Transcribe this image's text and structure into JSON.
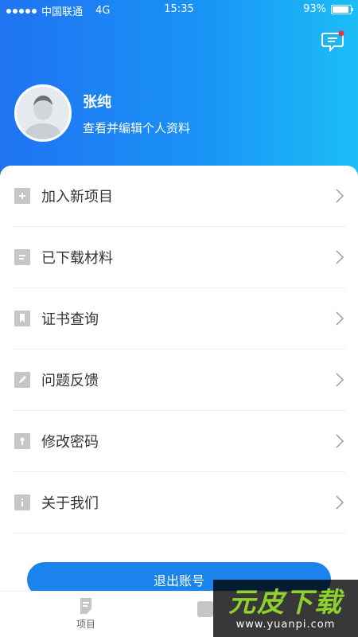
{
  "status_bar": {
    "carrier": "中国联通",
    "network": "4G",
    "time": "15:35",
    "battery": "93%",
    "battery_level": 0.93
  },
  "header": {
    "message_icon": "message-icon",
    "message_badge_color": "#e8343b"
  },
  "profile": {
    "name": "张纯",
    "edit_link": "查看并编辑个人资料"
  },
  "menu": {
    "items": [
      {
        "label": "加入新项目",
        "icon": "add-document-icon"
      },
      {
        "label": "已下载材料",
        "icon": "document-icon"
      },
      {
        "label": "证书查询",
        "icon": "bookmark-icon"
      },
      {
        "label": "问题反馈",
        "icon": "pencil-icon"
      },
      {
        "label": "修改密码",
        "icon": "key-icon"
      },
      {
        "label": "关于我们",
        "icon": "info-icon"
      }
    ]
  },
  "logout": {
    "label": "退出账号"
  },
  "tabbar": {
    "tabs": [
      {
        "label": "项目",
        "icon": "project-icon"
      }
    ]
  },
  "watermark": {
    "main": "元皮下载",
    "url": "www.yuanpi.com"
  },
  "colors": {
    "header_start": "#1f73f2",
    "header_end": "#1cbdf7",
    "accent": "#1a84ec",
    "menu_icon": "#c6c6c6"
  }
}
